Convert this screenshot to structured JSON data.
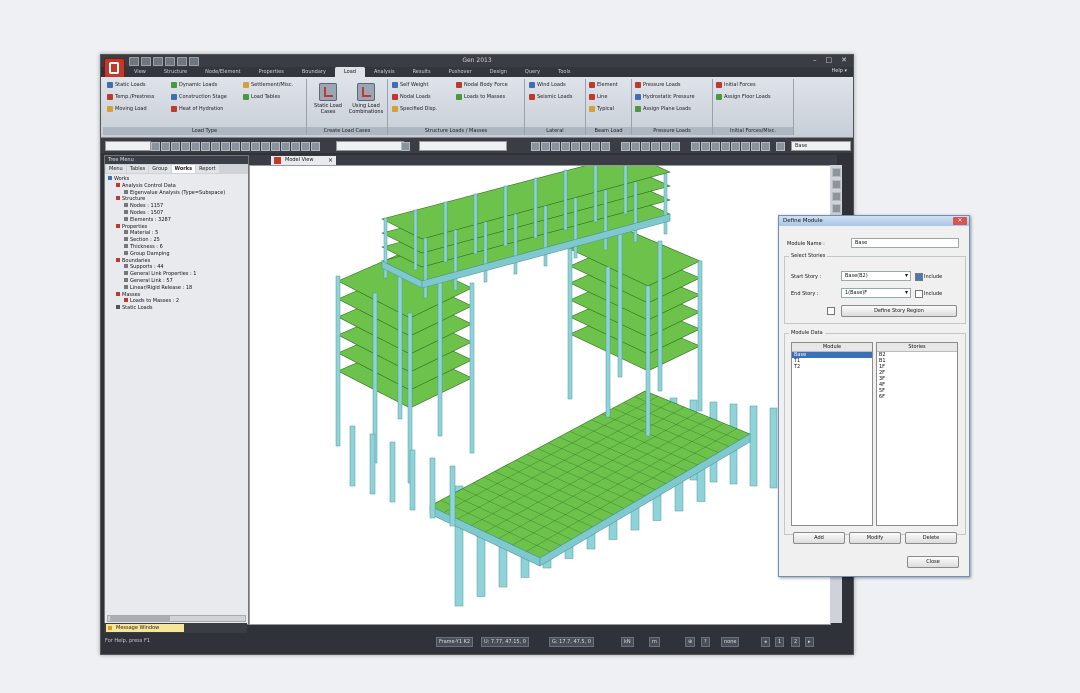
{
  "window": {
    "title": "Gen 2013",
    "controls": [
      "–",
      "□",
      "✕"
    ],
    "help": "Help ▾"
  },
  "menus": [
    "View",
    "Structure",
    "Node/Element",
    "Properties",
    "Boundary",
    "Load",
    "Analysis",
    "Results",
    "Pushover",
    "Design",
    "Query",
    "Tools"
  ],
  "active_menu": "Load",
  "ribbon": {
    "groups": [
      "Load Type",
      "Create Load Cases",
      "Structure Loads / Masses",
      "Lateral",
      "Beam Load",
      "Pressure Loads",
      "Initial Forces/Misc."
    ],
    "load_type": [
      "Static Loads",
      "Dynamic Loads",
      "Settlement/Misc.",
      "Temp./Prestress",
      "Construction Stage",
      "Load Tables",
      "Moving Load",
      "Heat of Hydration"
    ],
    "create_load_cases": [
      "Static Load Cases",
      "Using Load Combinations"
    ],
    "structure_loads": [
      "Self Weight",
      "Nodal Body Force",
      "Nodal Loads",
      "Loads to Masses",
      "Specified Disp."
    ],
    "lateral": [
      "Wind Loads",
      "Seismic Loads"
    ],
    "beam_load": [
      "Element",
      "Line",
      "Typical"
    ],
    "pressure": [
      "Pressure Loads",
      "Hydrostatic Pressure",
      "Assign Plane Loads"
    ],
    "initial": [
      "Initial Forces",
      "Assign Floor Loads"
    ]
  },
  "toolbar": {
    "selector": "Base"
  },
  "worktree": {
    "title": "Tree Menu",
    "tabs": [
      "Menu",
      "Tables",
      "Group",
      "Works",
      "Report"
    ],
    "active_tab": "Works",
    "items": [
      "Works",
      "Analysis Control Data",
      "Eigenvalue Analysis (Type=Subspace)",
      "Structure",
      "Nodes : 1157",
      "Nodes : 1507",
      "Elements : 3287",
      "Properties",
      "Material : 5",
      "Section : 25",
      "Thickness : 6",
      "Group Damping",
      "Boundaries",
      "Supports : 44",
      "General Link Properties : 1",
      "General Link : 57",
      "Linear/Rigid Release : 18",
      "Masses",
      "Loads to Masses : 2",
      "Static Loads"
    ]
  },
  "view": {
    "tab": "Model View"
  },
  "dialog": {
    "title": "Define Module",
    "module_name_label": "Module Name :",
    "module_name": "Base",
    "select_stories": "Select Stories",
    "start_story_label": "Start Story :",
    "start_story": "Base(B2)",
    "end_story_label": "End Story :",
    "end_story": "1(Base)F",
    "include": "Include",
    "define_story_region": "Define Story Region",
    "module_data": "Module Data",
    "col_module": "Module",
    "col_stories": "Stories",
    "modules": [
      "Base",
      "T1",
      "T2"
    ],
    "stories": [
      "B2",
      "B1",
      "1F",
      "2F",
      "3F",
      "4F",
      "5F",
      "6F"
    ],
    "add": "Add",
    "modify": "Modify",
    "delete": "Delete",
    "close": "Close"
  },
  "messages": {
    "tab": "Message Window"
  },
  "status": {
    "help": "For Help, press F1",
    "frame": "Frame-Y1 K2",
    "coord1": "U: 7.77, 47.15, 0",
    "coord2": "G: 17.7, 47.5, 0",
    "unit1": "kN",
    "unit2": "m",
    "unit3": "none",
    "page": "1",
    "page_total": "2"
  },
  "colors": {
    "slab": "#6cc24a",
    "frame": "#8fd3d8",
    "accent": "#c0392b",
    "selection": "#3b6fb6"
  }
}
